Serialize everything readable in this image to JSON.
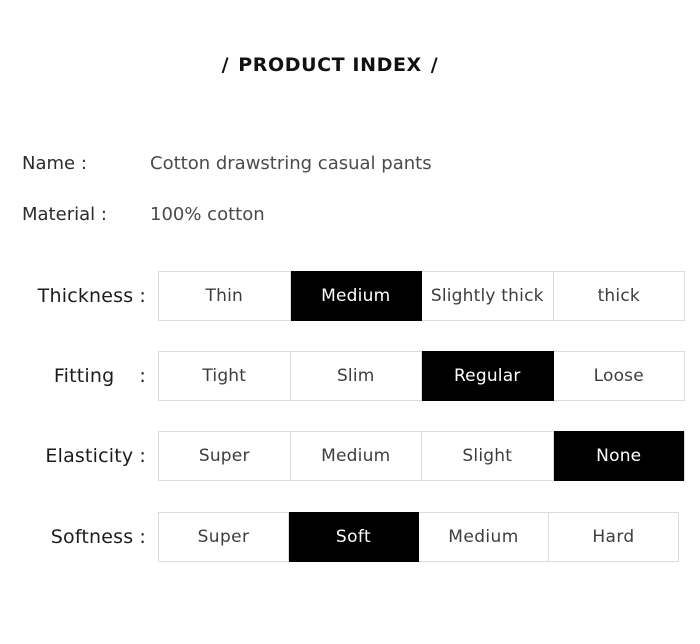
{
  "header": {
    "slash_left": "/",
    "title": "PRODUCT INDEX",
    "slash_right": "/"
  },
  "info": [
    {
      "label": "Name :",
      "value": "Cotton drawstring casual pants"
    },
    {
      "label": "Material :",
      "value": "100% cotton"
    }
  ],
  "attributes": [
    {
      "label": "Thickness",
      "colon": ":",
      "selected": "Medium",
      "options": [
        {
          "label": "Thin",
          "selected": false
        },
        {
          "label": "Medium",
          "selected": true
        },
        {
          "label": "Slightly thick",
          "selected": false
        },
        {
          "label": "thick",
          "selected": false
        }
      ]
    },
    {
      "label": "Fitting",
      "colon": ":",
      "selected": "Regular",
      "options": [
        {
          "label": "Tight",
          "selected": false
        },
        {
          "label": "Slim",
          "selected": false
        },
        {
          "label": "Regular",
          "selected": true
        },
        {
          "label": "Loose",
          "selected": false
        }
      ]
    },
    {
      "label": "Elasticity",
      "colon": ":",
      "selected": "None",
      "options": [
        {
          "label": "Super",
          "selected": false
        },
        {
          "label": "Medium",
          "selected": false
        },
        {
          "label": "Slight",
          "selected": false
        },
        {
          "label": "None",
          "selected": true
        }
      ]
    },
    {
      "label": "Softness",
      "colon": ":",
      "selected": "Soft",
      "options": [
        {
          "label": "Super",
          "selected": false
        },
        {
          "label": "Soft",
          "selected": true
        },
        {
          "label": "Medium",
          "selected": false
        },
        {
          "label": "Hard",
          "selected": false
        }
      ]
    }
  ],
  "colors": {
    "page_background": "#ffffff",
    "selected_background": "#000000",
    "selected_text": "#ffffff",
    "cell_border": "#dcdcdc",
    "label_text": "#1c1c1c",
    "value_text": "#4a4a4a"
  }
}
